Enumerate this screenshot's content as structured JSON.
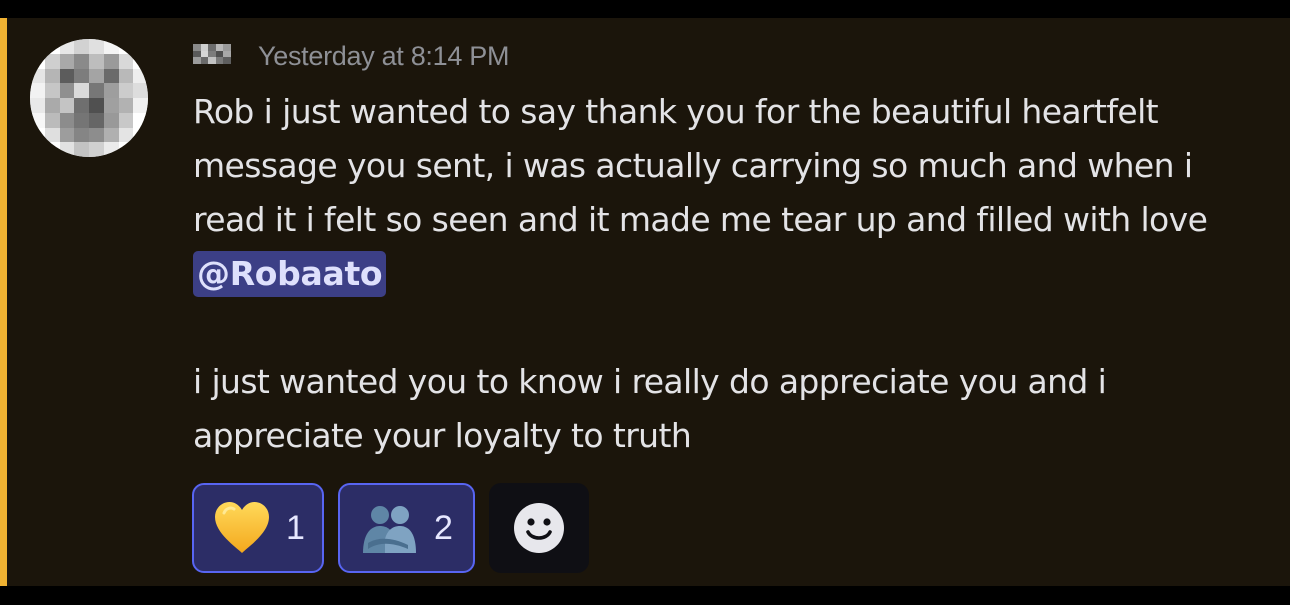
{
  "message": {
    "timestamp": "Yesterday at 8:14 PM",
    "paragraph1": "Rob i just wanted to say thank you for the beautiful heartfelt message you sent, i was actually carrying so much and when i read it i felt so seen and it made me tear up and filled with love",
    "mention": "@Robaato",
    "paragraph2": "i just wanted you to know i really do appreciate you and i appreciate your loyalty to truth"
  },
  "reactions": [
    {
      "icon": "yellow-heart-icon",
      "count": "1"
    },
    {
      "icon": "people-hugging-icon",
      "count": "2"
    }
  ],
  "add_reaction": {
    "icon": "smiley-face-icon"
  },
  "colors": {
    "background": "#1b150b",
    "mention_bar": "#f0b232",
    "mention_bg": "#3c3f86",
    "reaction_border": "#5865f2",
    "reaction_bg": "#2c2d66"
  }
}
